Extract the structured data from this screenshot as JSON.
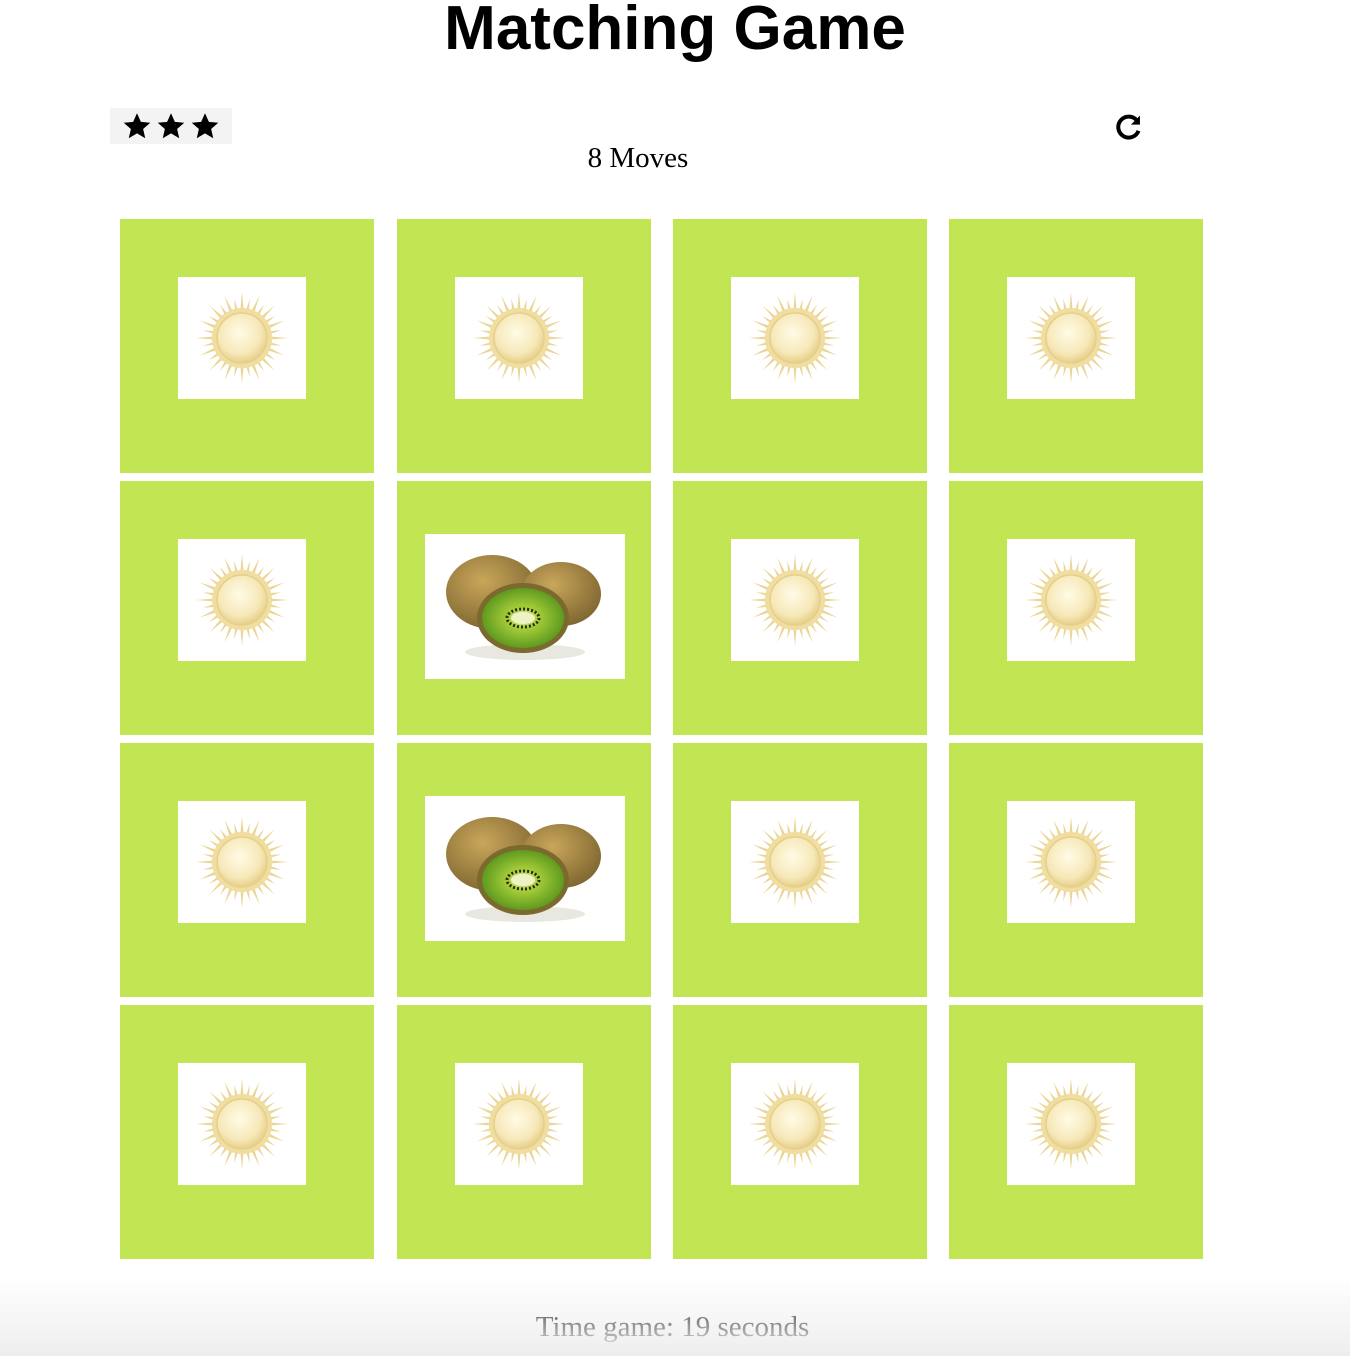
{
  "title": "Matching Game",
  "score_panel": {
    "stars": [
      {
        "icon": "star-icon",
        "filled": true
      },
      {
        "icon": "star-icon",
        "filled": true
      },
      {
        "icon": "star-icon",
        "filled": true
      }
    ],
    "moves_text": "8 Moves",
    "restart_icon": "restart-icon"
  },
  "colors": {
    "card_background": "#c2e554",
    "card_face": "#ffffff"
  },
  "deck": {
    "rows": 4,
    "columns": 4,
    "cards": [
      {
        "state": "closed",
        "image": "sun-icon"
      },
      {
        "state": "closed",
        "image": "sun-icon"
      },
      {
        "state": "closed",
        "image": "sun-icon"
      },
      {
        "state": "closed",
        "image": "sun-icon"
      },
      {
        "state": "closed",
        "image": "sun-icon"
      },
      {
        "state": "open",
        "image": "kiwi-image"
      },
      {
        "state": "closed",
        "image": "sun-icon"
      },
      {
        "state": "closed",
        "image": "sun-icon"
      },
      {
        "state": "closed",
        "image": "sun-icon"
      },
      {
        "state": "open",
        "image": "kiwi-image"
      },
      {
        "state": "closed",
        "image": "sun-icon"
      },
      {
        "state": "closed",
        "image": "sun-icon"
      },
      {
        "state": "closed",
        "image": "sun-icon"
      },
      {
        "state": "closed",
        "image": "sun-icon"
      },
      {
        "state": "closed",
        "image": "sun-icon"
      },
      {
        "state": "closed",
        "image": "sun-icon"
      }
    ]
  },
  "timer_text": "Time game: 19 seconds"
}
